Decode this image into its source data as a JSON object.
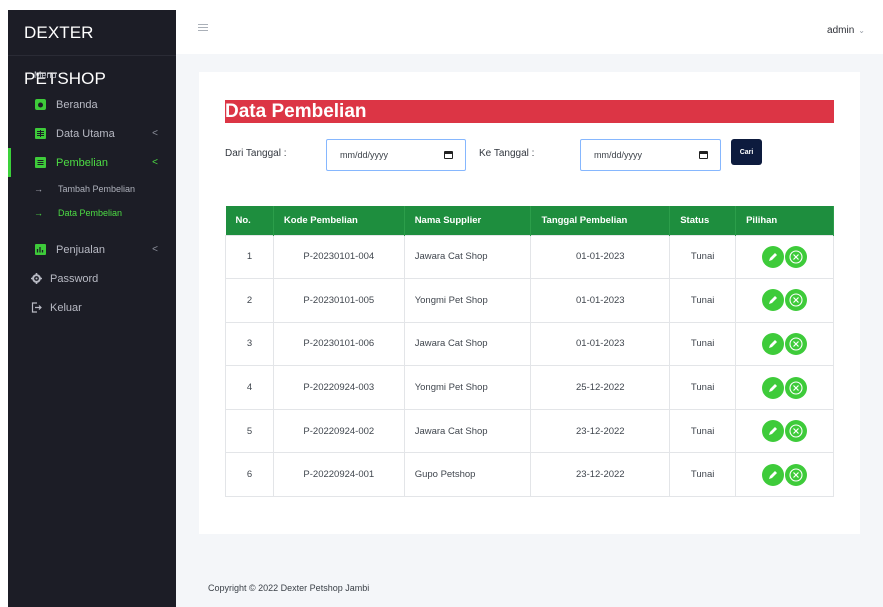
{
  "brand": "DEXTER PETSHOP",
  "sidebar": {
    "menu_header": "Menu",
    "items": [
      {
        "label": "Beranda",
        "icon": "home-icon"
      },
      {
        "label": "Data Utama",
        "icon": "table-icon",
        "caret": "<"
      },
      {
        "label": "Pembelian",
        "icon": "list-icon",
        "caret": "<",
        "active": true
      },
      {
        "label": "Penjualan",
        "icon": "chart-icon",
        "caret": "<"
      },
      {
        "label": "Password",
        "icon": "gear-icon"
      },
      {
        "label": "Keluar",
        "icon": "logout-icon"
      }
    ],
    "sub_items": [
      {
        "label": "Tambah Pembelian",
        "arrow": "→"
      },
      {
        "label": "Data Pembelian",
        "arrow": "→",
        "active": true
      }
    ]
  },
  "topbar": {
    "user": "admin"
  },
  "main": {
    "title": "Data Pembelian",
    "filter": {
      "from_label": "Dari Tanggal :",
      "to_label": "Ke Tanggal :",
      "from_value": "mm/dd/yyyy",
      "to_value": "mm/dd/yyyy",
      "search_label": "Cari"
    },
    "table": {
      "headers": [
        "No.",
        "Kode Pembelian",
        "Nama Supplier",
        "Tanggal Pembelian",
        "Status",
        "Pilihan"
      ],
      "rows": [
        {
          "no": "1",
          "kode": "P-20230101-004",
          "supplier": "Jawara Cat Shop",
          "tanggal": "01-01-2023",
          "status": "Tunai"
        },
        {
          "no": "2",
          "kode": "P-20230101-005",
          "supplier": "Yongmi Pet Shop",
          "tanggal": "01-01-2023",
          "status": "Tunai"
        },
        {
          "no": "3",
          "kode": "P-20230101-006",
          "supplier": "Jawara Cat Shop",
          "tanggal": "01-01-2023",
          "status": "Tunai"
        },
        {
          "no": "4",
          "kode": "P-20220924-003",
          "supplier": "Yongmi Pet Shop",
          "tanggal": "25-12-2022",
          "status": "Tunai"
        },
        {
          "no": "5",
          "kode": "P-20220924-002",
          "supplier": "Jawara Cat Shop",
          "tanggal": "23-12-2022",
          "status": "Tunai"
        },
        {
          "no": "6",
          "kode": "P-20220924-001",
          "supplier": "Gupo Petshop",
          "tanggal": "23-12-2022",
          "status": "Tunai"
        }
      ]
    }
  },
  "footer": "Copyright © 2022 Dexter Petshop Jambi",
  "colors": {
    "sidebar": "#1c1d26",
    "accent_green": "#3ecb3a",
    "title_red": "#dc3545",
    "table_header": "#1e8e3e",
    "button_navy": "#0d1b3e"
  }
}
